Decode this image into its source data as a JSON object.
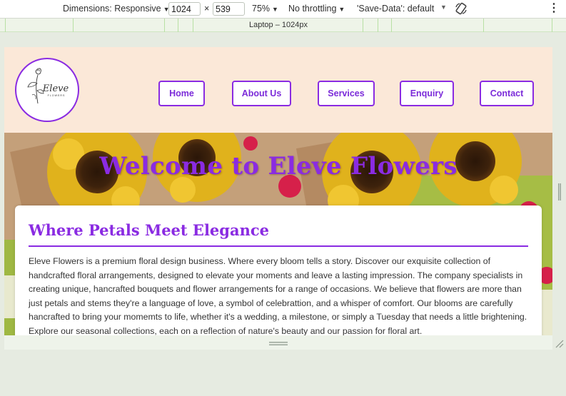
{
  "devtools": {
    "dimensions_label": "Dimensions: Responsive",
    "width_value": "1024",
    "times": "×",
    "height_value": "539",
    "zoom": "75%",
    "throttling": "No throttling",
    "save_data": "'Save-Data': default",
    "dropdown_icon": "▼",
    "rotate_icon": "rotate-icon",
    "menu_icon": "⋮"
  },
  "media_bar": {
    "label": "Laptop – 1024px"
  },
  "site": {
    "logo": {
      "name": "Eleve",
      "sub": "FLOWERS"
    },
    "nav": [
      "Home",
      "About Us",
      "Services",
      "Enquiry",
      "Contact"
    ],
    "hero_title": "Welcome to Eleve Flowers",
    "section_title": "Where Petals Meet Elegance",
    "section_body": "Eleve Flowers is a premium floral design business. Where every bloom tells a story. Discover our exquisite collection of handcrafted floral arrangements, designed to elevate your moments and leave a lasting impression. The company specialists in creating unique, hancrafted bouquets and flower arrangements for a range of occasions. We believe that flowers are more than just petals and stems they're a language of love, a symbol of celebrattion, and a whisper of comfort. Our blooms are carefully hancrafted to bring your momemts to life, whether it's a wedding, a milestone, or simply a Tuesday that needs a little brightening. Explore our seasonal collections, each on a reflection of nature's beauty and our passion for floral art."
  },
  "colors": {
    "accent": "#8a2be2",
    "header_bg": "#fbe8d8",
    "devtools_bg": "#e6ebe1"
  }
}
